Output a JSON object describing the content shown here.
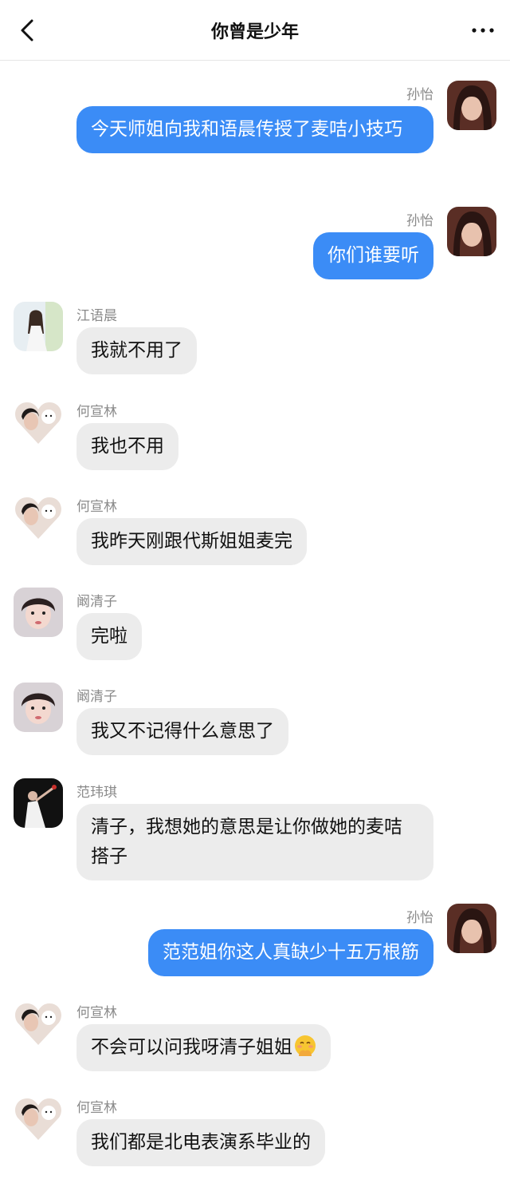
{
  "header": {
    "title": "你曾是少年"
  },
  "messages": [
    {
      "side": "right",
      "sender": "孙怡",
      "text": "今天师姐向我和语晨传授了麦咭小技巧"
    },
    {
      "side": "right",
      "sender": "孙怡",
      "text": "你们谁要听"
    },
    {
      "side": "left",
      "sender": "江语晨",
      "text": "我就不用了"
    },
    {
      "side": "left",
      "sender": "何宣林",
      "text": "我也不用"
    },
    {
      "side": "left",
      "sender": "何宣林",
      "text": "我昨天刚跟代斯姐姐麦完"
    },
    {
      "side": "left",
      "sender": "阚清子",
      "text": "完啦"
    },
    {
      "side": "left",
      "sender": "阚清子",
      "text": "我又不记得什么意思了"
    },
    {
      "side": "left",
      "sender": "范玮琪",
      "text": "清子，我想她的意思是让你做她的麦咭搭子"
    },
    {
      "side": "right",
      "sender": "孙怡",
      "text": "范范姐你这人真缺少十五万根筋"
    },
    {
      "side": "left",
      "sender": "何宣林",
      "text": "不会可以问我呀清子姐姐",
      "emoji": "shy-smile-emoji"
    },
    {
      "side": "left",
      "sender": "何宣林",
      "text": "我们都是北电表演系毕业的"
    }
  ],
  "colors": {
    "outgoing_bubble": "#3b8cf6",
    "incoming_bubble": "#ececec",
    "name_text": "#8a8a8a"
  },
  "icons": {
    "back": "chevron-left-icon",
    "more": "more-dots-icon"
  }
}
